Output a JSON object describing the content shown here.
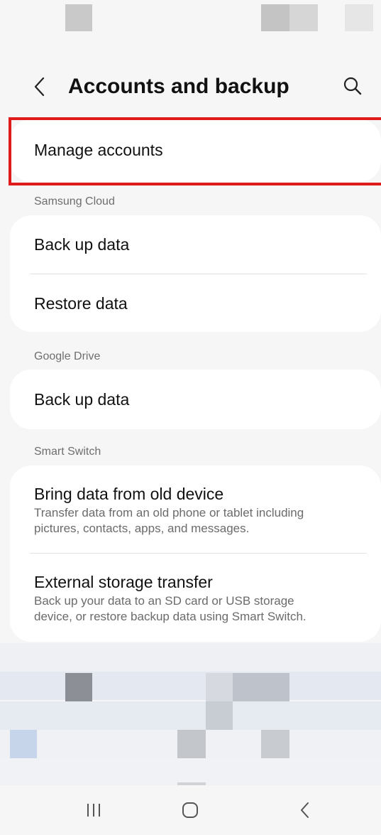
{
  "header": {
    "title": "Accounts and backup",
    "back_icon": "chevron-left-icon",
    "search_icon": "search-icon"
  },
  "manage_accounts": {
    "label": "Manage accounts"
  },
  "sections": {
    "samsung_cloud": {
      "label": "Samsung Cloud",
      "items": [
        {
          "title": "Back up data"
        },
        {
          "title": "Restore data"
        }
      ]
    },
    "google_drive": {
      "label": "Google Drive",
      "items": [
        {
          "title": "Back up data"
        }
      ]
    },
    "smart_switch": {
      "label": "Smart Switch",
      "items": [
        {
          "title": "Bring data from old device",
          "subtitle_line1": "Transfer data from an old phone or tablet including",
          "subtitle_line2": "pictures, contacts, apps, and messages."
        },
        {
          "title": "External storage transfer",
          "subtitle_line1": "Back up your data to an SD card or USB storage",
          "subtitle_line2": "device, or restore backup data using Smart Switch."
        }
      ]
    }
  },
  "nav": {
    "recents_icon": "recents-icon",
    "home_icon": "home-icon",
    "back_icon": "back-icon"
  },
  "colors": {
    "highlight": "#e01b1b",
    "background": "#f6f6f6",
    "card": "#ffffff"
  }
}
